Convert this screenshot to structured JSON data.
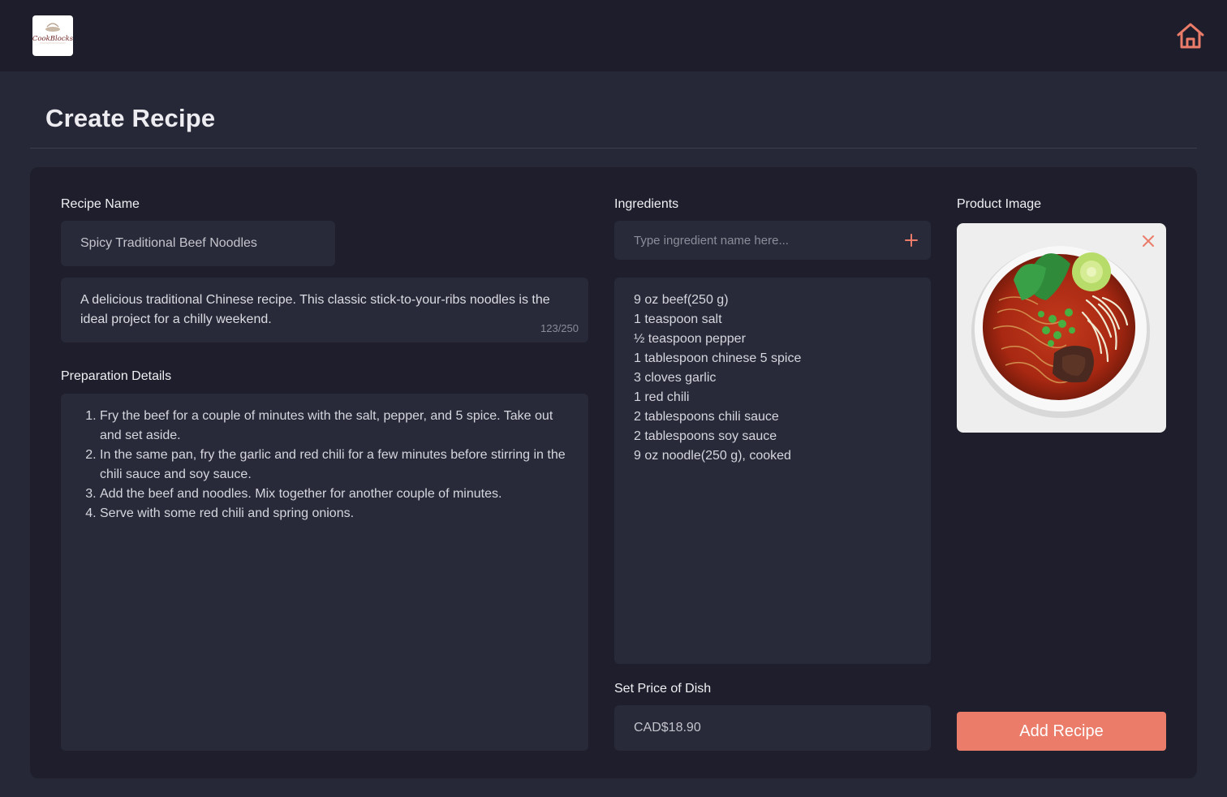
{
  "brand": {
    "logo_text": "CookBlocks"
  },
  "header": {
    "home_icon": "home-icon"
  },
  "page": {
    "title": "Create Recipe"
  },
  "form": {
    "recipe_name_label": "Recipe Name",
    "recipe_name_value": "Spicy Traditional Beef Noodles",
    "description_value": "A delicious traditional Chinese recipe. This classic stick-to-your-ribs noodles is the ideal project for a chilly weekend.",
    "description_counter": "123/250",
    "prep_label": "Preparation Details",
    "prep_steps": [
      "Fry the beef for a couple of minutes with the salt, pepper, and 5 spice. Take out and set aside.",
      "In the same pan, fry the garlic and red chili for a few minutes before stirring in the chili sauce and soy sauce.",
      "Add the beef and noodles. Mix together for another couple of minutes.",
      "Serve with some red chili and spring onions."
    ],
    "ingredients_label": "Ingredients",
    "ingredient_placeholder": "Type ingredient name here...",
    "ingredients": [
      "9 oz beef(250 g)",
      "1 teaspoon salt",
      "½ teaspoon pepper",
      "1 tablespoon chinese 5 spice",
      "3 cloves garlic",
      "1 red chili",
      "2 tablespoons chili sauce",
      "2 tablespoons soy sauce",
      "9 oz noodle(250 g), cooked"
    ],
    "price_label": "Set Price of Dish",
    "price_value": "CAD$18.90",
    "image_label": "Product Image",
    "submit_label": "Add Recipe"
  },
  "colors": {
    "accent": "#ea7c69",
    "background": "#262837",
    "card": "#1e1e2c",
    "field": "#282a39"
  }
}
